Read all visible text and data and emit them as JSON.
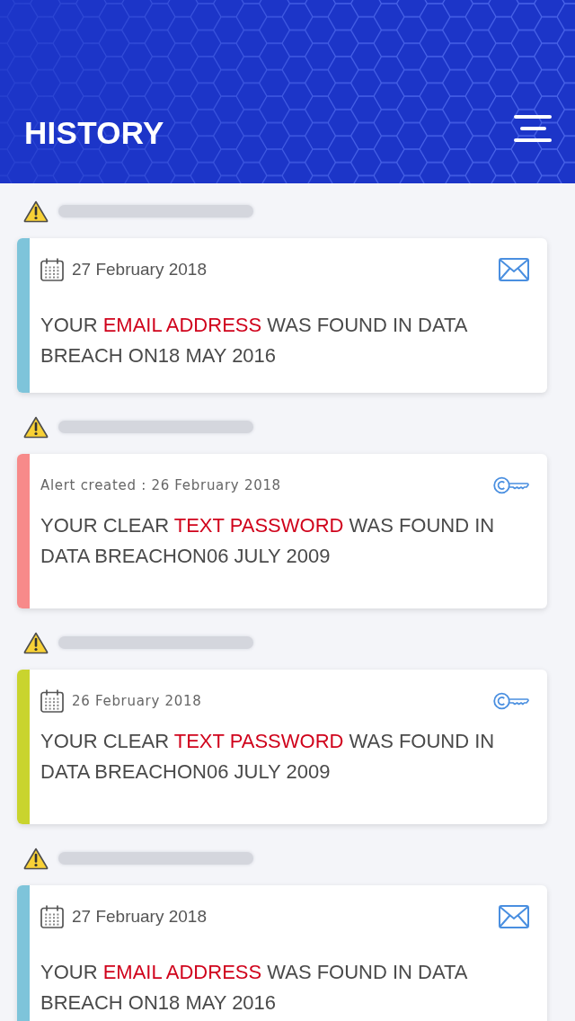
{
  "header": {
    "title": "HISTORY"
  },
  "alerts": [
    {
      "kind": "email",
      "color": "#7ec4da",
      "calendar_icon": true,
      "date": "27 February 2018",
      "message": [
        {
          "text": "YOUR ",
          "highlight": false
        },
        {
          "text": "EMAIL ADDRESS",
          "highlight": true
        },
        {
          "text": " WAS FOUND IN DATA BREACH ON18 MAY 2016",
          "highlight": false
        }
      ]
    },
    {
      "kind": "password",
      "color": "#f78a8a",
      "calendar_icon": false,
      "date": "Alert created : 26 February 2018",
      "message": [
        {
          "text": "YOUR CLEAR ",
          "highlight": false
        },
        {
          "text": "TEXT PASSWORD",
          "highlight": true
        },
        {
          "text": " WAS FOUND IN DATA BREACHON06 JULY 2009",
          "highlight": false
        }
      ]
    },
    {
      "kind": "password",
      "color": "#c9d42e",
      "calendar_icon": true,
      "date": "26 February 2018",
      "message": [
        {
          "text": "YOUR CLEAR ",
          "highlight": false
        },
        {
          "text": "TEXT PASSWORD",
          "highlight": true
        },
        {
          "text": " WAS FOUND IN DATA BREACHON06 JULY 2009",
          "highlight": false
        }
      ]
    },
    {
      "kind": "email",
      "color": "#7ec4da",
      "calendar_icon": true,
      "date": "27 February 2018",
      "message": [
        {
          "text": "YOUR ",
          "highlight": false
        },
        {
          "text": "EMAIL ADDRESS",
          "highlight": true
        },
        {
          "text": " WAS FOUND IN DATA BREACH ON18 MAY 2016",
          "highlight": false
        }
      ]
    }
  ]
}
